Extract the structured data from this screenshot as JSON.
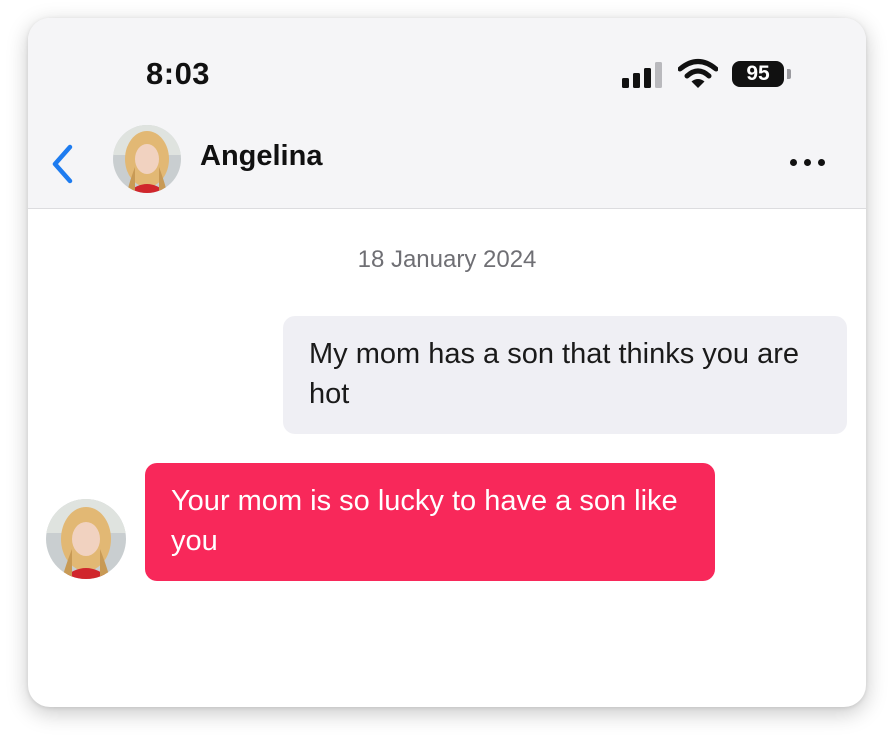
{
  "status_bar": {
    "time": "8:03",
    "battery": "95",
    "signal_bars_active": 3,
    "signal_bars_total": 4
  },
  "header": {
    "contact_name": "Angelina",
    "back_icon": "chevron-left-icon",
    "more_icon": "ellipsis-icon",
    "accent_color": "#1e7cf0"
  },
  "conversation": {
    "date": "18 January 2024",
    "messages": [
      {
        "direction": "outgoing",
        "text": "My mom has a son that thinks you are hot",
        "bubble_color": "#efeff4"
      },
      {
        "direction": "incoming",
        "sender": "Angelina",
        "text": "Your mom is so lucky to have a son like you",
        "bubble_color": "#f8285a"
      }
    ]
  }
}
